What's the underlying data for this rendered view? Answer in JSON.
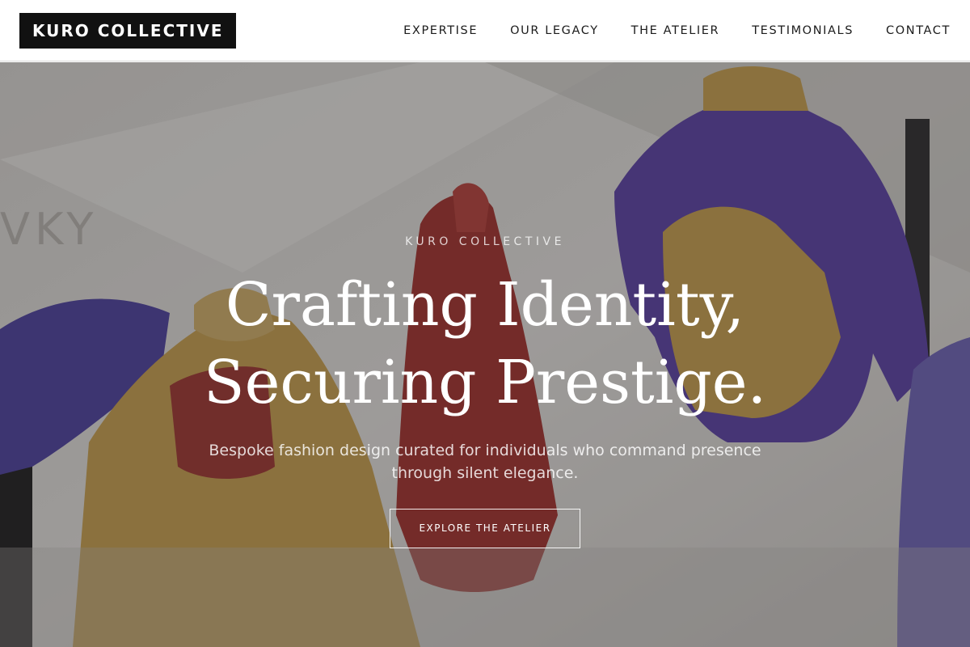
{
  "header": {
    "logo": "KURO COLLECTIVE",
    "nav": [
      {
        "label": "EXPERTISE"
      },
      {
        "label": "OUR LEGACY"
      },
      {
        "label": "THE ATELIER"
      },
      {
        "label": "TESTIMONIALS"
      },
      {
        "label": "CONTACT"
      }
    ]
  },
  "hero": {
    "eyebrow": "KURO COLLECTIVE",
    "headline_line1": "Crafting Identity,",
    "headline_line2": "Securing Prestige.",
    "subtitle": "Bespoke fashion design curated for individuals who command presence through silent elegance.",
    "cta_label": "EXPLORE THE ATELIER",
    "background_wall_text": "VKY"
  },
  "colors": {
    "header_bg": "#ffffff",
    "logo_bg": "#111111",
    "jacket_yellow": "#c9a24a",
    "jacket_purple": "#4b3a9e",
    "jacket_red": "#9e2f2a"
  }
}
